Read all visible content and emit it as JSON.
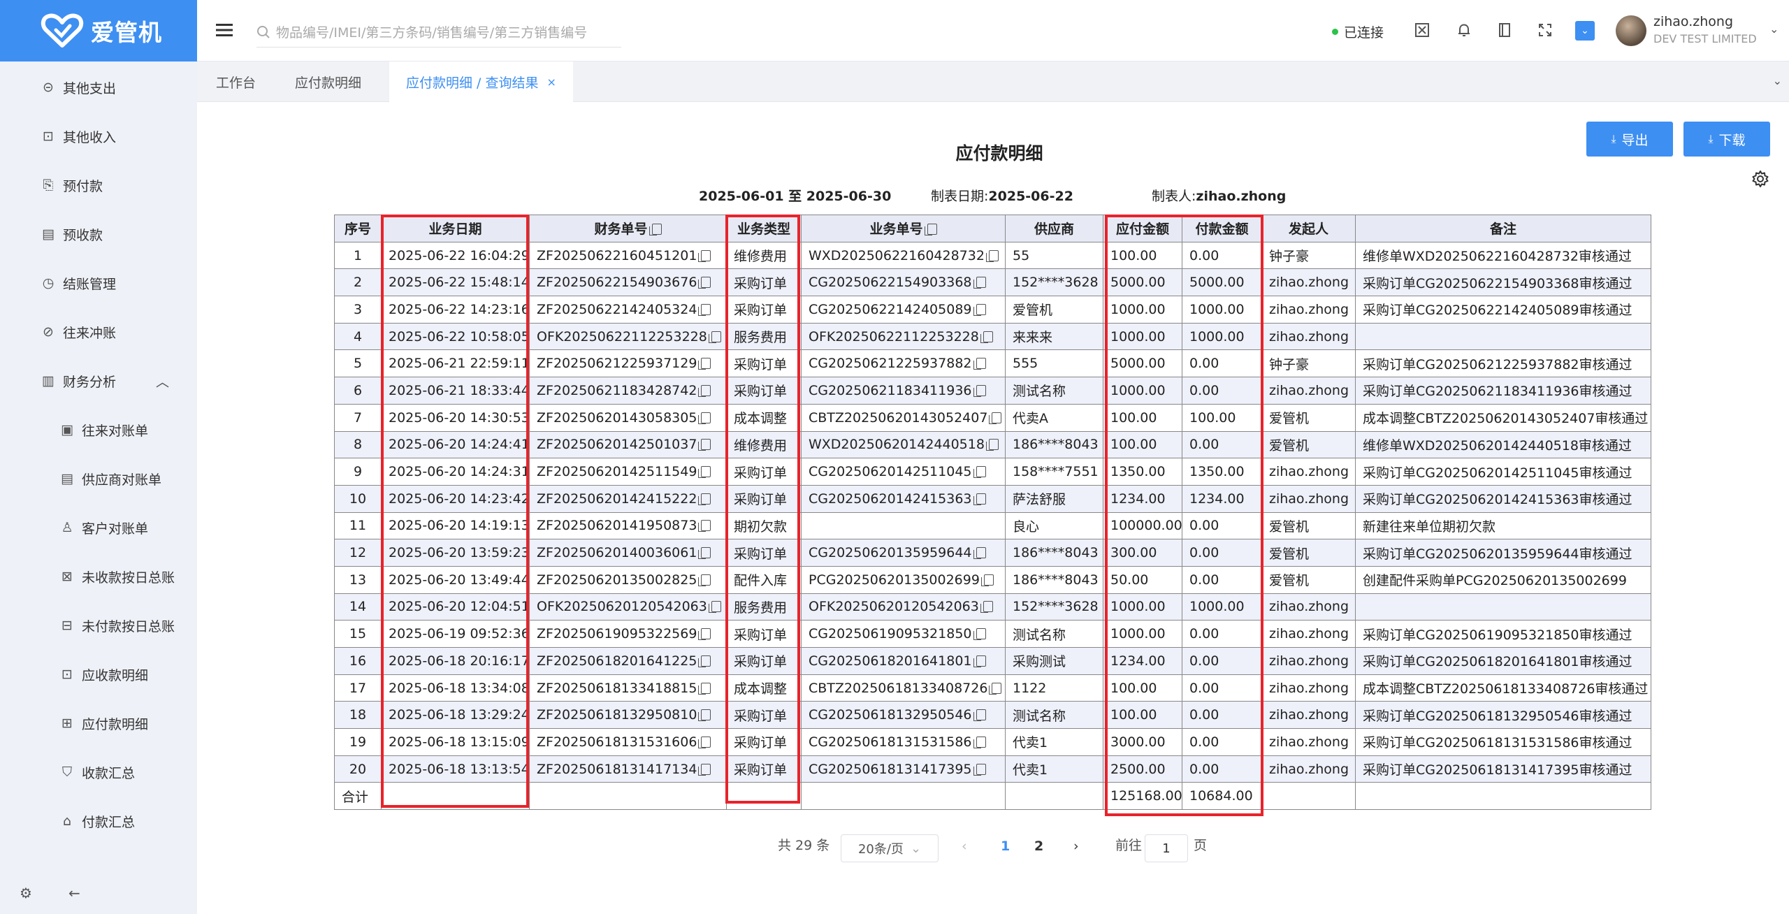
{
  "brand": {
    "name": "爱管机",
    "color": "#3d8ff2"
  },
  "sidebar": {
    "items": [
      {
        "label": "其他支出",
        "icon": "expense-circle-icon"
      },
      {
        "label": "其他收入",
        "icon": "income-receipt-icon"
      },
      {
        "label": "预付款",
        "icon": "prepay-icon"
      },
      {
        "label": "预收款",
        "icon": "prereceive-icon"
      },
      {
        "label": "结账管理",
        "icon": "history-clock-icon"
      },
      {
        "label": "往来冲账",
        "icon": "offset-link-icon"
      }
    ],
    "group": {
      "label": "财务分析",
      "icon": "chart-analysis-icon",
      "expanded": true
    },
    "subitems": [
      {
        "label": "往来对账单",
        "icon": "statement-icon"
      },
      {
        "label": "供应商对账单",
        "icon": "supplier-doc-icon"
      },
      {
        "label": "客户对账单",
        "icon": "customer-user-icon"
      },
      {
        "label": "未收款按日总账",
        "icon": "unreceived-ledger-icon"
      },
      {
        "label": "未付款按日总账",
        "icon": "unpaid-ledger-icon"
      },
      {
        "label": "应收款明细",
        "icon": "receivable-detail-icon"
      },
      {
        "label": "应付款明细",
        "icon": "payable-detail-icon"
      },
      {
        "label": "收款汇总",
        "icon": "receipt-summary-icon"
      },
      {
        "label": "付款汇总",
        "icon": "payment-summary-icon"
      }
    ]
  },
  "topbar": {
    "search_placeholder": "物品编号/IMEI/第三方条码/销售编号/第三方销售编号",
    "status": "已连接",
    "status_color": "#2dc24b",
    "user_name": "zihao.zhong",
    "user_org": "DEV TEST LIMITED"
  },
  "tabs": [
    {
      "label": "工作台"
    },
    {
      "label": "应付款明细"
    },
    {
      "label": "应付款明细 / 查询结果",
      "active": true
    }
  ],
  "actions": {
    "export": "导出",
    "download": "下载"
  },
  "report": {
    "title": "应付款明细",
    "date_range": "2025-06-01 至 2025-06-30",
    "made_date_label": "制表日期:",
    "made_date": "2025-06-22",
    "maker_label": "制表人:",
    "maker": "zihao.zhong"
  },
  "table": {
    "headers": [
      "序号",
      "业务日期",
      "财务单号",
      "业务类型",
      "业务单号",
      "供应商",
      "应付金额",
      "付款金额",
      "发起人",
      "备注"
    ],
    "rows": [
      [
        "1",
        "2025-06-22 16:04:29",
        "ZF20250622160451201",
        "维修费用",
        "WXD20250622160428732",
        "55",
        "100.00",
        "0.00",
        "钟子豪",
        "维修单WXD20250622160428732审核通过"
      ],
      [
        "2",
        "2025-06-22 15:48:14",
        "ZF20250622154903676",
        "采购订单",
        "CG20250622154903368",
        "152****3628",
        "5000.00",
        "5000.00",
        "zihao.zhong",
        "采购订单CG20250622154903368审核通过"
      ],
      [
        "3",
        "2025-06-22 14:23:16",
        "ZF20250622142405324",
        "采购订单",
        "CG20250622142405089",
        "爱管机",
        "1000.00",
        "1000.00",
        "zihao.zhong",
        "采购订单CG20250622142405089审核通过"
      ],
      [
        "4",
        "2025-06-22 10:58:05",
        "OFK20250622112253228",
        "服务费用",
        "OFK20250622112253228",
        "来来来",
        "1000.00",
        "1000.00",
        "zihao.zhong",
        ""
      ],
      [
        "5",
        "2025-06-21 22:59:11",
        "ZF20250621225937129",
        "采购订单",
        "CG20250621225937882",
        "555",
        "5000.00",
        "0.00",
        "钟子豪",
        "采购订单CG20250621225937882审核通过"
      ],
      [
        "6",
        "2025-06-21 18:33:44",
        "ZF20250621183428742",
        "采购订单",
        "CG20250621183411936",
        "测试名称",
        "1000.00",
        "0.00",
        "zihao.zhong",
        "采购订单CG20250621183411936审核通过"
      ],
      [
        "7",
        "2025-06-20 14:30:53",
        "ZF20250620143058305",
        "成本调整",
        "CBTZ20250620143052407",
        "代卖A",
        "100.00",
        "100.00",
        "爱管机",
        "成本调整CBTZ20250620143052407审核通过"
      ],
      [
        "8",
        "2025-06-20 14:24:41",
        "ZF20250620142501037",
        "维修费用",
        "WXD20250620142440518",
        "186****8043",
        "100.00",
        "0.00",
        "爱管机",
        "维修单WXD20250620142440518审核通过"
      ],
      [
        "9",
        "2025-06-20 14:24:31",
        "ZF20250620142511549",
        "采购订单",
        "CG20250620142511045",
        "158****7551",
        "1350.00",
        "1350.00",
        "zihao.zhong",
        "采购订单CG20250620142511045审核通过"
      ],
      [
        "10",
        "2025-06-20 14:23:42",
        "ZF20250620142415222",
        "采购订单",
        "CG20250620142415363",
        "萨法舒服",
        "1234.00",
        "1234.00",
        "zihao.zhong",
        "采购订单CG20250620142415363审核通过"
      ],
      [
        "11",
        "2025-06-20 14:19:13",
        "ZF20250620141950873",
        "期初欠款",
        "",
        "良心",
        "100000.00",
        "0.00",
        "爱管机",
        "新建往来单位期初欠款"
      ],
      [
        "12",
        "2025-06-20 13:59:23",
        "ZF20250620140036061",
        "采购订单",
        "CG20250620135959644",
        "186****8043",
        "300.00",
        "0.00",
        "爱管机",
        "采购订单CG20250620135959644审核通过"
      ],
      [
        "13",
        "2025-06-20 13:49:44",
        "ZF20250620135002825",
        "配件入库",
        "PCG20250620135002699",
        "186****8043",
        "50.00",
        "0.00",
        "爱管机",
        "创建配件采购单PCG20250620135002699"
      ],
      [
        "14",
        "2025-06-20 12:04:51",
        "OFK20250620120542063",
        "服务费用",
        "OFK20250620120542063",
        "152****3628",
        "1000.00",
        "1000.00",
        "zihao.zhong",
        ""
      ],
      [
        "15",
        "2025-06-19 09:52:36",
        "ZF20250619095322569",
        "采购订单",
        "CG20250619095321850",
        "测试名称",
        "1000.00",
        "0.00",
        "zihao.zhong",
        "采购订单CG20250619095321850审核通过"
      ],
      [
        "16",
        "2025-06-18 20:16:17",
        "ZF20250618201641225",
        "采购订单",
        "CG20250618201641801",
        "采购测试",
        "1234.00",
        "0.00",
        "zihao.zhong",
        "采购订单CG20250618201641801审核通过"
      ],
      [
        "17",
        "2025-06-18 13:34:08",
        "ZF20250618133418815",
        "成本调整",
        "CBTZ20250618133408726",
        "1122",
        "100.00",
        "0.00",
        "zihao.zhong",
        "成本调整CBTZ20250618133408726审核通过"
      ],
      [
        "18",
        "2025-06-18 13:29:24",
        "ZF20250618132950810",
        "采购订单",
        "CG20250618132950546",
        "测试名称",
        "100.00",
        "0.00",
        "zihao.zhong",
        "采购订单CG20250618132950546审核通过"
      ],
      [
        "19",
        "2025-06-18 13:15:09",
        "ZF20250618131531606",
        "采购订单",
        "CG20250618131531586",
        "代卖1",
        "3000.00",
        "0.00",
        "zihao.zhong",
        "采购订单CG20250618131531586审核通过"
      ],
      [
        "20",
        "2025-06-18 13:13:54",
        "ZF20250618131417134",
        "采购订单",
        "CG20250618131417395",
        "代卖1",
        "2500.00",
        "0.00",
        "zihao.zhong",
        "采购订单CG20250618131417395审核通过"
      ]
    ],
    "total_label": "合计",
    "total_payable": "125168.00",
    "total_paid": "10684.00"
  },
  "highlight_color": "#e8232b",
  "pagination": {
    "total": "共 29 条",
    "page_size": "20条/页",
    "pages": [
      "1",
      "2"
    ],
    "current": "1",
    "goto_label": "前往",
    "goto_value": "1",
    "goto_suffix": "页"
  }
}
